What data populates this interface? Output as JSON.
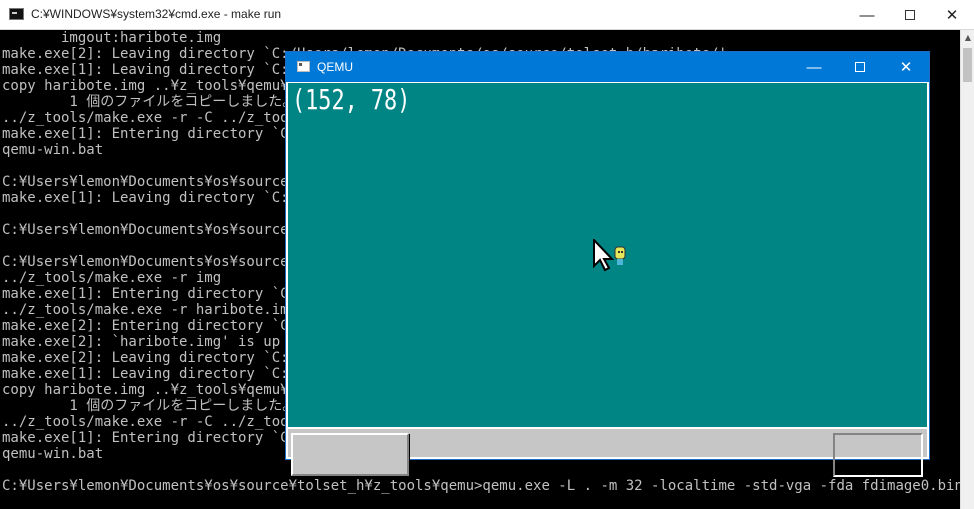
{
  "cmd": {
    "title": "C:¥WINDOWS¥system32¥cmd.exe - make  run",
    "lines": [
      "       imgout:haribote.img",
      "make.exe[2]: Leaving directory `C:/Users/lemon/Documents/os/source/tolset_h/haribote/'",
      "make.exe[1]: Leaving directory `C:/U",
      "copy haribote.img ..¥z_tools¥qemu¥fd",
      "        1 個のファイルをコピーしました。",
      "../z_tools/make.exe -r -C ../z_tools",
      "make.exe[1]: Entering directory `C:/",
      "qemu-win.bat",
      "",
      "C:¥Users¥lemon¥Documents¥os¥source¥t",
      "make.exe[1]: Leaving directory `C:/U",
      "",
      "C:¥Users¥lemon¥Documents¥os¥source¥t",
      "",
      "C:¥Users¥lemon¥Documents¥os¥source¥t",
      "../z_tools/make.exe -r img",
      "make.exe[1]: Entering directory `C:/",
      "../z_tools/make.exe -r haribote.img",
      "make.exe[2]: Entering directory `C:/",
      "make.exe[2]: `haribote.img' is up to",
      "make.exe[2]: Leaving directory `C:/U",
      "make.exe[1]: Leaving directory `C:/U",
      "copy haribote.img ..¥z_tools¥qemu¥fd",
      "        1 個のファイルをコピーしました。",
      "../z_tools/make.exe -r -C ../z_tools",
      "make.exe[1]: Entering directory `C:/",
      "qemu-win.bat",
      "",
      "C:¥Users¥lemon¥Documents¥os¥source¥tolset_h¥z_tools¥qemu>qemu.exe -L . -m 32 -localtime -std-vga -fda fdimage0.bin"
    ]
  },
  "qemu": {
    "title": "QEMU",
    "screen_text": "(152, 78)",
    "colors": {
      "desktop": "#008484",
      "taskbar": "#c6c6c6"
    }
  },
  "icons": {
    "cmd_window": "console-icon",
    "qemu_window": "qemu-window-icon",
    "mouse": "mouse-cursor-icon"
  },
  "caption": {
    "minimize": "—",
    "close": "✕"
  }
}
